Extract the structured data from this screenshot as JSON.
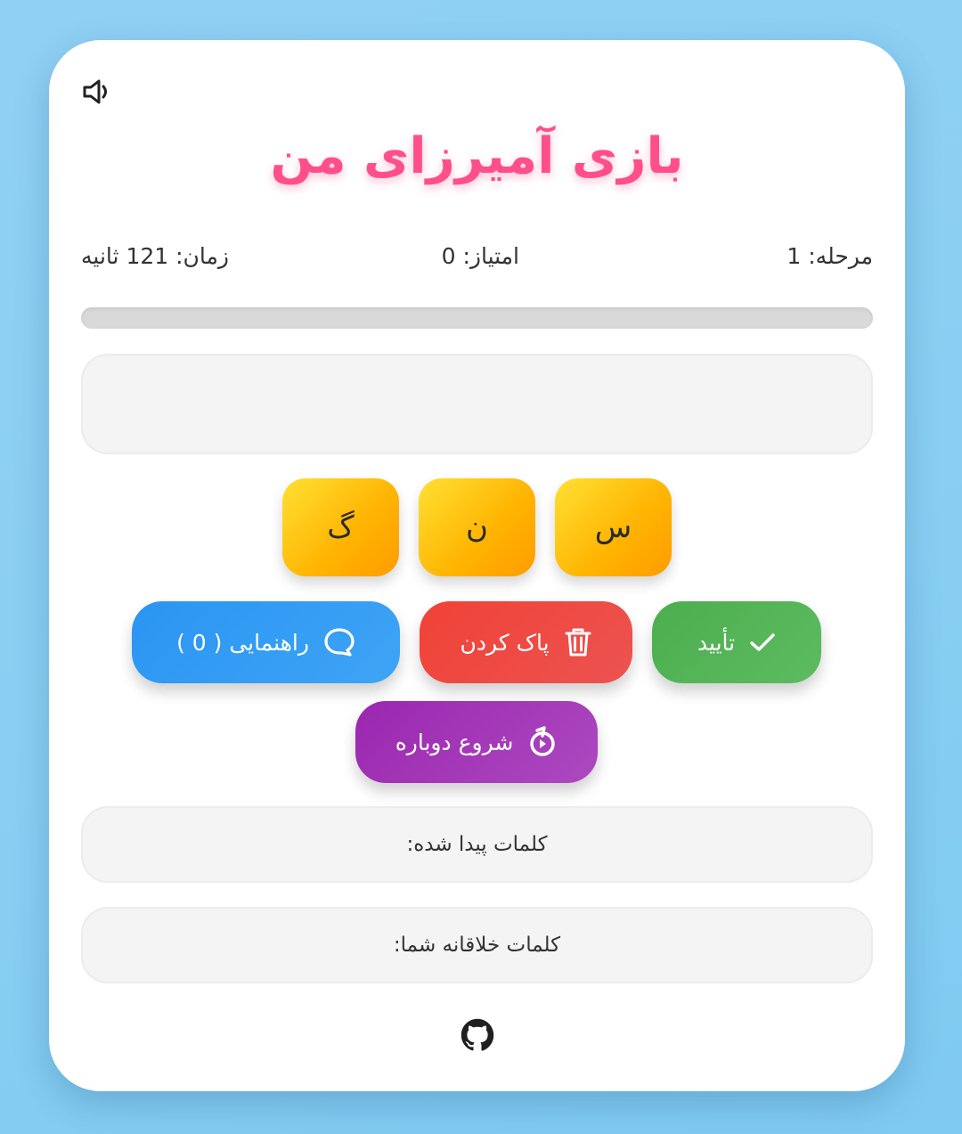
{
  "title": "بازی آمیرزای من",
  "stats": {
    "level_label": "مرحله: 1",
    "score_label": "امتیاز: 0",
    "time_label": "زمان: 121 ثانیه"
  },
  "progress": {
    "value_percent": 0
  },
  "current_word": "",
  "letters": [
    "س",
    "ن",
    "گ"
  ],
  "buttons": {
    "confirm": "تأیید",
    "clear": "پاک کردن",
    "hint": "راهنمایی ( 0 )",
    "restart": "شروع دوباره"
  },
  "found_words_label": "کلمات پیدا شده:",
  "creative_words_label": "کلمات خلاقانه شما:",
  "icons": {
    "sound": "speaker-muted-icon",
    "confirm": "check-icon",
    "clear": "trash-icon",
    "hint": "chat-bubble-icon",
    "restart": "restart-icon",
    "footer": "github-icon"
  },
  "colors": {
    "title": "#ff4f8b",
    "tile": "#ffb300",
    "confirm": "#4cae4f",
    "clear": "#f04237",
    "hint": "#2a95f2",
    "restart": "#9b27af"
  }
}
